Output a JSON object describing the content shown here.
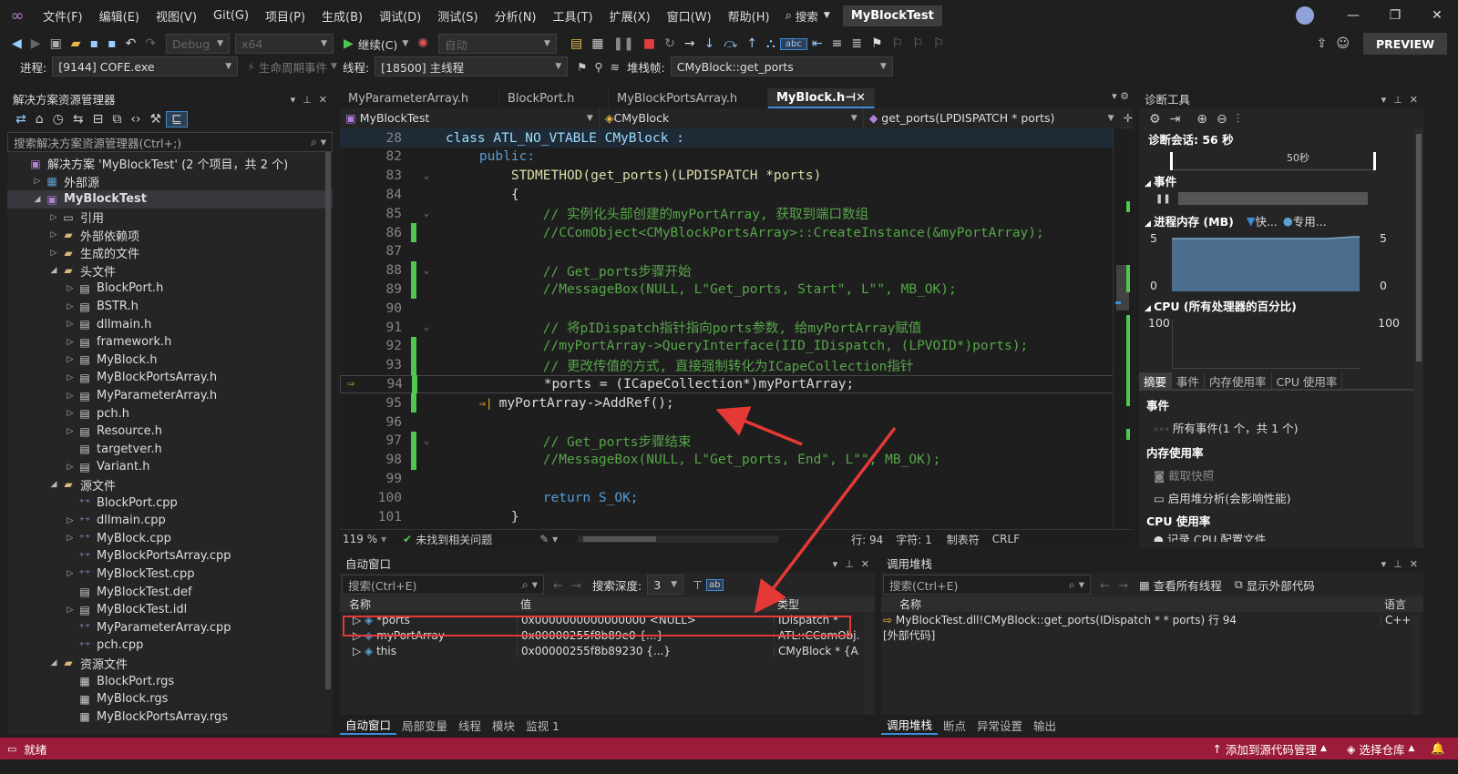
{
  "menu": [
    "文件(F)",
    "编辑(E)",
    "视图(V)",
    "Git(G)",
    "项目(P)",
    "生成(B)",
    "调试(D)",
    "测试(S)",
    "分析(N)",
    "工具(T)",
    "扩展(X)",
    "窗口(W)",
    "帮助(H)"
  ],
  "search_label": "搜索",
  "window_title": "MyBlockTest",
  "preview_label": "PREVIEW",
  "toolbar": {
    "config": "Debug",
    "platform": "x64",
    "continue": "继续(C)",
    "auto": "自动"
  },
  "debugbar": {
    "process_label": "进程:",
    "process": "[9144] COFE.exe",
    "lifecycle": "生命周期事件",
    "thread_label": "线程:",
    "thread": "[18500] 主线程",
    "stack_label": "堆栈帧:",
    "stack": "CMyBlock::get_ports"
  },
  "solution": {
    "title": "解决方案资源管理器",
    "search": "搜索解决方案资源管理器(Ctrl+;)",
    "items": [
      {
        "label": "解决方案 'MyBlockTest' (2 个项目，共 2 个)",
        "icon": "solution",
        "indent": 0,
        "arrow": ""
      },
      {
        "label": "外部源",
        "icon": "ext-source",
        "indent": 1,
        "arrow": "▷"
      },
      {
        "label": "MyBlockTest",
        "icon": "project",
        "indent": 1,
        "arrow": "◢",
        "bold": true
      },
      {
        "label": "引用",
        "icon": "reference",
        "indent": 2,
        "arrow": "▷"
      },
      {
        "label": "外部依赖项",
        "icon": "folder",
        "indent": 2,
        "arrow": "▷"
      },
      {
        "label": "生成的文件",
        "icon": "folder",
        "indent": 2,
        "arrow": "▷"
      },
      {
        "label": "头文件",
        "icon": "folder",
        "indent": 2,
        "arrow": "◢"
      },
      {
        "label": "BlockPort.h",
        "icon": "header",
        "indent": 3,
        "arrow": "▷"
      },
      {
        "label": "BSTR.h",
        "icon": "header",
        "indent": 3,
        "arrow": "▷"
      },
      {
        "label": "dllmain.h",
        "icon": "header",
        "indent": 3,
        "arrow": "▷"
      },
      {
        "label": "framework.h",
        "icon": "header",
        "indent": 3,
        "arrow": "▷"
      },
      {
        "label": "MyBlock.h",
        "icon": "header",
        "indent": 3,
        "arrow": "▷"
      },
      {
        "label": "MyBlockPortsArray.h",
        "icon": "header",
        "indent": 3,
        "arrow": "▷"
      },
      {
        "label": "MyParameterArray.h",
        "icon": "header",
        "indent": 3,
        "arrow": "▷"
      },
      {
        "label": "pch.h",
        "icon": "header",
        "indent": 3,
        "arrow": "▷"
      },
      {
        "label": "Resource.h",
        "icon": "header",
        "indent": 3,
        "arrow": "▷"
      },
      {
        "label": "targetver.h",
        "icon": "header",
        "indent": 3,
        "arrow": ""
      },
      {
        "label": "Variant.h",
        "icon": "header",
        "indent": 3,
        "arrow": "▷"
      },
      {
        "label": "源文件",
        "icon": "folder",
        "indent": 2,
        "arrow": "◢"
      },
      {
        "label": "BlockPort.cpp",
        "icon": "cpp",
        "indent": 3,
        "arrow": ""
      },
      {
        "label": "dllmain.cpp",
        "icon": "cpp",
        "indent": 3,
        "arrow": "▷"
      },
      {
        "label": "MyBlock.cpp",
        "icon": "cpp",
        "indent": 3,
        "arrow": "▷"
      },
      {
        "label": "MyBlockPortsArray.cpp",
        "icon": "cpp",
        "indent": 3,
        "arrow": ""
      },
      {
        "label": "MyBlockTest.cpp",
        "icon": "cpp",
        "indent": 3,
        "arrow": "▷"
      },
      {
        "label": "MyBlockTest.def",
        "icon": "file",
        "indent": 3,
        "arrow": ""
      },
      {
        "label": "MyBlockTest.idl",
        "icon": "file",
        "indent": 3,
        "arrow": "▷"
      },
      {
        "label": "MyParameterArray.cpp",
        "icon": "cpp",
        "indent": 3,
        "arrow": ""
      },
      {
        "label": "pch.cpp",
        "icon": "cpp",
        "indent": 3,
        "arrow": ""
      },
      {
        "label": "资源文件",
        "icon": "folder",
        "indent": 2,
        "arrow": "◢"
      },
      {
        "label": "BlockPort.rgs",
        "icon": "rgs",
        "indent": 3,
        "arrow": ""
      },
      {
        "label": "MyBlock.rgs",
        "icon": "rgs",
        "indent": 3,
        "arrow": ""
      },
      {
        "label": "MyBlockPortsArray.rgs",
        "icon": "rgs",
        "indent": 3,
        "arrow": ""
      }
    ]
  },
  "editor": {
    "tabs": [
      "MyParameterArray.h",
      "BlockPort.h",
      "MyBlockPortsArray.h",
      "MyBlock.h"
    ],
    "nav": [
      "MyBlockTest",
      "CMyBlock",
      "get_ports(LPDISPATCH * ports)"
    ],
    "sticky": {
      "num": "28",
      "text": "class ATL_NO_VTABLE CMyBlock :"
    },
    "lines": [
      {
        "n": "82",
        "t": "public:",
        "k": "kw",
        "ind": 0
      },
      {
        "n": "83",
        "t": "STDMETHOD(get_ports)(LPDISPATCH *ports)",
        "k": "fnl",
        "ind": 1
      },
      {
        "n": "84",
        "t": "{",
        "k": "pl",
        "ind": 1
      },
      {
        "n": "85",
        "t": "// 实例化头部创建的myPortArray, 获取到端口数组",
        "k": "cm",
        "ind": 2
      },
      {
        "n": "86",
        "t": "//CComObject<CMyBlockPortsArray>::CreateInstance(&myPortArray);",
        "k": "cm",
        "ind": 2
      },
      {
        "n": "87",
        "t": "",
        "k": "pl",
        "ind": 2
      },
      {
        "n": "88",
        "t": "// Get_ports步骤开始",
        "k": "cm",
        "ind": 2
      },
      {
        "n": "89",
        "t": "//MessageBox(NULL, L\"Get_ports, Start\", L\"\", MB_OK);",
        "k": "cm",
        "ind": 2
      },
      {
        "n": "90",
        "t": "",
        "k": "pl",
        "ind": 2
      },
      {
        "n": "91",
        "t": "// 将pIDispatch指针指向ports参数, 给myPortArray赋值",
        "k": "cm",
        "ind": 2
      },
      {
        "n": "92",
        "t": "//myPortArray->QueryInterface(IID_IDispatch, (LPVOID*)ports);",
        "k": "cm",
        "ind": 2
      },
      {
        "n": "93",
        "t": "// 更改传值的方式, 直接强制转化为ICapeCollection指针",
        "k": "cm",
        "ind": 2
      },
      {
        "n": "94",
        "t": "*ports = (ICapeCollection*)myPortArray;",
        "k": "cast",
        "ind": 2
      },
      {
        "n": "95",
        "t": "myPortArray->AddRef();",
        "k": "call",
        "ind": 2
      },
      {
        "n": "96",
        "t": "",
        "k": "pl",
        "ind": 2
      },
      {
        "n": "97",
        "t": "// Get_ports步骤结束",
        "k": "cm",
        "ind": 2
      },
      {
        "n": "98",
        "t": "//MessageBox(NULL, L\"Get_ports, End\", L\"\", MB_OK);",
        "k": "cm",
        "ind": 2
      },
      {
        "n": "99",
        "t": "",
        "k": "pl",
        "ind": 2
      },
      {
        "n": "100",
        "t": "return S_OK;",
        "k": "ret",
        "ind": 2
      },
      {
        "n": "101",
        "t": "}",
        "k": "pl",
        "ind": 1
      }
    ],
    "status": {
      "zoom": "119 %",
      "issues": "未找到相关问题",
      "line": "行: 94",
      "col": "字符: 1",
      "tab": "制表符",
      "eol": "CRLF"
    }
  },
  "autos": {
    "title": "自动窗口",
    "search": "搜索(Ctrl+E)",
    "depth_label": "搜索深度:",
    "depth": "3",
    "cols": [
      "名称",
      "值",
      "类型"
    ],
    "rows": [
      {
        "name": "*ports",
        "value": "0x0000000000000000 <NULL>",
        "type": "IDispatch *"
      },
      {
        "name": "myPortArray",
        "value": "0x00000255f8b89e0 {...}",
        "type": "ATL::CComObj..."
      },
      {
        "name": "this",
        "value": "0x00000255f8b89230 {...}",
        "type": "CMyBlock * {A..."
      }
    ],
    "tabs": [
      "自动窗口",
      "局部变量",
      "线程",
      "模块",
      "监视 1"
    ]
  },
  "callstack": {
    "title": "调用堆栈",
    "search": "搜索(Ctrl+E)",
    "all_threads": "查看所有线程",
    "show_external": "显示外部代码",
    "cols": [
      "名称",
      "语言"
    ],
    "rows": [
      {
        "name": "MyBlockTest.dll!CMyBlock::get_ports(IDispatch * * ports) 行 94",
        "lang": "C++"
      },
      {
        "name": "[外部代码]",
        "lang": ""
      }
    ],
    "tabs": [
      "调用堆栈",
      "断点",
      "异常设置",
      "输出"
    ]
  },
  "diag": {
    "title": "诊断工具",
    "session": "诊断会话: 56 秒",
    "timeline_tick": "50秒",
    "events": "事件",
    "mem_title": "进程内存 (MB)",
    "mem_legend1": "快...",
    "mem_legend2": "专用...",
    "mem_max": "5",
    "mem_min": "0",
    "cpu_title": "CPU (所有处理器的百分比)",
    "cpu_max": "100",
    "tabs": [
      "摘要",
      "事件",
      "内存使用率",
      "CPU 使用率"
    ],
    "sec_events": "事件",
    "all_events": "所有事件(1 个，共 1 个)",
    "sec_mem": "内存使用率",
    "snapshot": "截取快照",
    "heap": "启用堆分析(会影响性能)",
    "sec_cpu": "CPU 使用率",
    "cpu_record": "记录 CPU 配置文件"
  },
  "statusbar": {
    "ready": "就绪",
    "source_control": "添加到源代码管理",
    "repo": "选择仓库"
  }
}
